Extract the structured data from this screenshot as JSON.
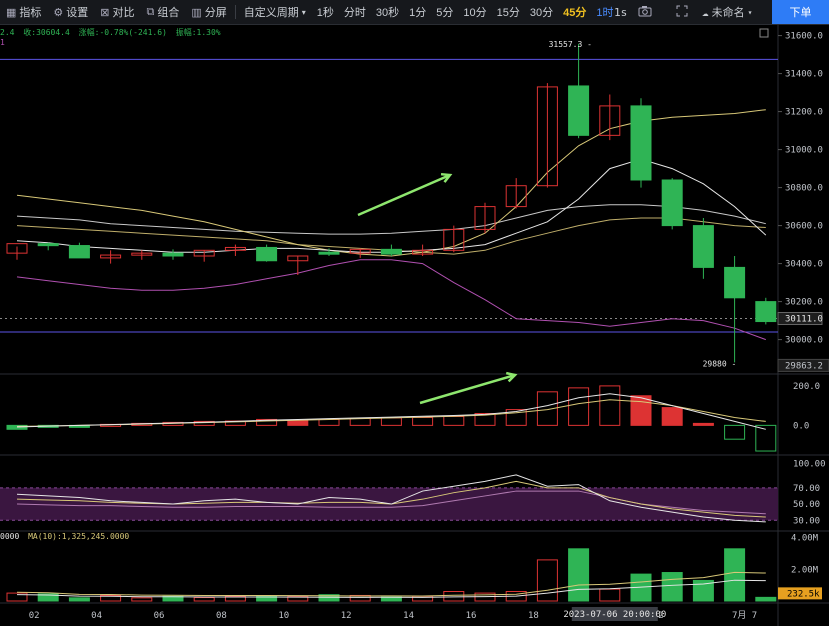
{
  "toolbar": {
    "indicators": "指标",
    "settings": "设置",
    "compare": "对比",
    "combine": "组合",
    "split": "分屏",
    "custom_period": "自定义周期",
    "intervals": [
      "1秒",
      "分时",
      "30秒",
      "1分",
      "5分",
      "10分",
      "15分",
      "30分",
      "45分",
      "1时"
    ],
    "active_interval": "45分",
    "right_interval": "1s",
    "cloud_label": "未命名",
    "order_button": "下单"
  },
  "info_bar": {
    "left": "2.4",
    "close": "收:30604.4",
    "change": "涨幅:-0.78%(-241.6)",
    "amplitude": "振幅:1.30%",
    "marker": "1"
  },
  "vol_info": {
    "left": "0000",
    "ma": "MA(10):1,325,245.0000"
  },
  "colors": {
    "up": "#d33",
    "down": "#2fb455",
    "ma_yellow": "#d8c878",
    "ma_white": "#e6e6e6",
    "purple": "#b050b0",
    "blue": "#5b55e6",
    "arrow": "#8ee66e"
  },
  "chart_data": {
    "type": "candlestick",
    "x_ticks": [
      "02",
      "04",
      "06",
      "08",
      "10",
      "12",
      "14",
      "16",
      "18",
      "20",
      "22",
      "7月 7"
    ],
    "crosshair_label": "2023-07-06 20:00:00",
    "price_axis": {
      "ticks": [
        30000,
        30200,
        30400,
        30600,
        30800,
        31000,
        31200,
        31400,
        31600
      ],
      "range": [
        29840,
        31640
      ]
    },
    "hline_price": 31475,
    "lower_hline_price": 30040,
    "current_price_label": "30111.0",
    "low_price_label": "29863.2",
    "annotations": {
      "high": "31557.3",
      "low": "29880"
    },
    "candles": [
      {
        "o": 30455,
        "h": 30490,
        "l": 30420,
        "c": 30505
      },
      {
        "o": 30505,
        "h": 30510,
        "l": 30470,
        "c": 30495
      },
      {
        "o": 30495,
        "h": 30510,
        "l": 30440,
        "c": 30430
      },
      {
        "o": 30430,
        "h": 30470,
        "l": 30400,
        "c": 30445
      },
      {
        "o": 30445,
        "h": 30470,
        "l": 30420,
        "c": 30455
      },
      {
        "o": 30455,
        "h": 30475,
        "l": 30420,
        "c": 30440
      },
      {
        "o": 30440,
        "h": 30470,
        "l": 30410,
        "c": 30470
      },
      {
        "o": 30470,
        "h": 30500,
        "l": 30440,
        "c": 30485
      },
      {
        "o": 30485,
        "h": 30500,
        "l": 30410,
        "c": 30415
      },
      {
        "o": 30415,
        "h": 30440,
        "l": 30340,
        "c": 30440
      },
      {
        "o": 30460,
        "h": 30480,
        "l": 30440,
        "c": 30455
      },
      {
        "o": 30455,
        "h": 30480,
        "l": 30430,
        "c": 30475
      },
      {
        "o": 30475,
        "h": 30500,
        "l": 30440,
        "c": 30450
      },
      {
        "o": 30450,
        "h": 30500,
        "l": 30440,
        "c": 30470
      },
      {
        "o": 30470,
        "h": 30600,
        "l": 30460,
        "c": 30580
      },
      {
        "o": 30580,
        "h": 30720,
        "l": 30560,
        "c": 30700
      },
      {
        "o": 30700,
        "h": 30850,
        "l": 30690,
        "c": 30810
      },
      {
        "o": 30810,
        "h": 31350,
        "l": 30800,
        "c": 31330
      },
      {
        "o": 31335,
        "h": 31557,
        "l": 31060,
        "c": 31075
      },
      {
        "o": 31075,
        "h": 31290,
        "l": 31050,
        "c": 31230
      },
      {
        "o": 31230,
        "h": 31270,
        "l": 30800,
        "c": 30840
      },
      {
        "o": 30840,
        "h": 30850,
        "l": 30580,
        "c": 30600
      },
      {
        "o": 30600,
        "h": 30640,
        "l": 30320,
        "c": 30380
      },
      {
        "o": 30380,
        "h": 30440,
        "l": 29880,
        "c": 30220
      },
      {
        "o": 30200,
        "h": 30220,
        "l": 30080,
        "c": 30095
      }
    ],
    "ma_yellow": [
      30760,
      30740,
      30720,
      30700,
      30680,
      30650,
      30620,
      30580,
      30540,
      30500,
      30470,
      30450,
      30440,
      30460,
      30490,
      30560,
      30700,
      30880,
      31020,
      31110,
      31150,
      31170,
      31180,
      31190,
      31210
    ],
    "ma_light": [
      30650,
      30640,
      30630,
      30610,
      30600,
      30590,
      30580,
      30570,
      30565,
      30560,
      30555,
      30555,
      30560,
      30570,
      30580,
      30600,
      30640,
      30680,
      30700,
      30710,
      30710,
      30700,
      30680,
      30650,
      30610
    ],
    "ma_white": [
      30520,
      30510,
      30490,
      30480,
      30470,
      30460,
      30460,
      30470,
      30480,
      30480,
      30470,
      30460,
      30460,
      30470,
      30480,
      30500,
      30560,
      30620,
      30740,
      30900,
      30950,
      30900,
      30820,
      30700,
      30550
    ],
    "ma_dim": [
      30600,
      30590,
      30580,
      30570,
      30560,
      30550,
      30540,
      30530,
      30520,
      30500,
      30490,
      30480,
      30470,
      30460,
      30450,
      30470,
      30520,
      30560,
      30600,
      30630,
      30640,
      30640,
      30620,
      30600,
      30590
    ],
    "ma_purple": [
      30330,
      30310,
      30290,
      30270,
      30260,
      30260,
      30270,
      30290,
      30320,
      30350,
      30390,
      30420,
      30420,
      30400,
      30300,
      30210,
      30110,
      30100,
      30090,
      30070,
      30090,
      30110,
      30100,
      30060,
      30000
    ],
    "macd": {
      "ticks": [
        200,
        0
      ],
      "range": [
        -140,
        240
      ],
      "hist": [
        -20,
        -10,
        -5,
        5,
        10,
        15,
        20,
        22,
        30,
        25,
        30,
        35,
        38,
        40,
        45,
        60,
        80,
        170,
        190,
        200,
        150,
        90,
        10,
        -70,
        -130
      ],
      "signal": [
        -5,
        -3,
        0,
        3,
        6,
        10,
        14,
        18,
        22,
        26,
        30,
        34,
        38,
        42,
        46,
        52,
        64,
        80,
        110,
        130,
        120,
        100,
        70,
        40,
        20
      ],
      "dif": [
        -8,
        -4,
        0,
        4,
        8,
        12,
        16,
        20,
        26,
        30,
        34,
        38,
        42,
        46,
        50,
        56,
        70,
        100,
        140,
        160,
        140,
        100,
        60,
        20,
        -20
      ]
    },
    "rsi": {
      "ticks": [
        100,
        70,
        50,
        30
      ],
      "range": [
        18,
        108
      ],
      "line1": [
        62,
        60,
        58,
        54,
        52,
        50,
        54,
        56,
        52,
        50,
        58,
        56,
        50,
        66,
        72,
        78,
        86,
        72,
        74,
        54,
        46,
        40,
        34,
        30,
        28
      ],
      "line2": [
        56,
        55,
        54,
        52,
        51,
        50,
        51,
        52,
        52,
        51,
        52,
        52,
        50,
        56,
        64,
        70,
        78,
        70,
        70,
        58,
        50,
        44,
        40,
        36,
        34
      ],
      "line3": [
        50,
        49,
        48,
        48,
        47,
        46,
        46,
        47,
        47,
        47,
        46,
        46,
        46,
        48,
        54,
        60,
        66,
        66,
        66,
        58,
        50,
        46,
        42,
        40,
        38
      ]
    },
    "volume": {
      "ticks": [
        "4.00M",
        "2.00M"
      ],
      "current": "232.5k",
      "values": [
        0.5,
        0.45,
        0.2,
        0.35,
        0.2,
        0.3,
        0.22,
        0.3,
        0.3,
        0.28,
        0.4,
        0.35,
        0.25,
        0.3,
        0.6,
        0.5,
        0.6,
        2.6,
        3.3,
        0.75,
        1.7,
        1.8,
        1.3,
        3.3,
        0.23
      ]
    }
  }
}
